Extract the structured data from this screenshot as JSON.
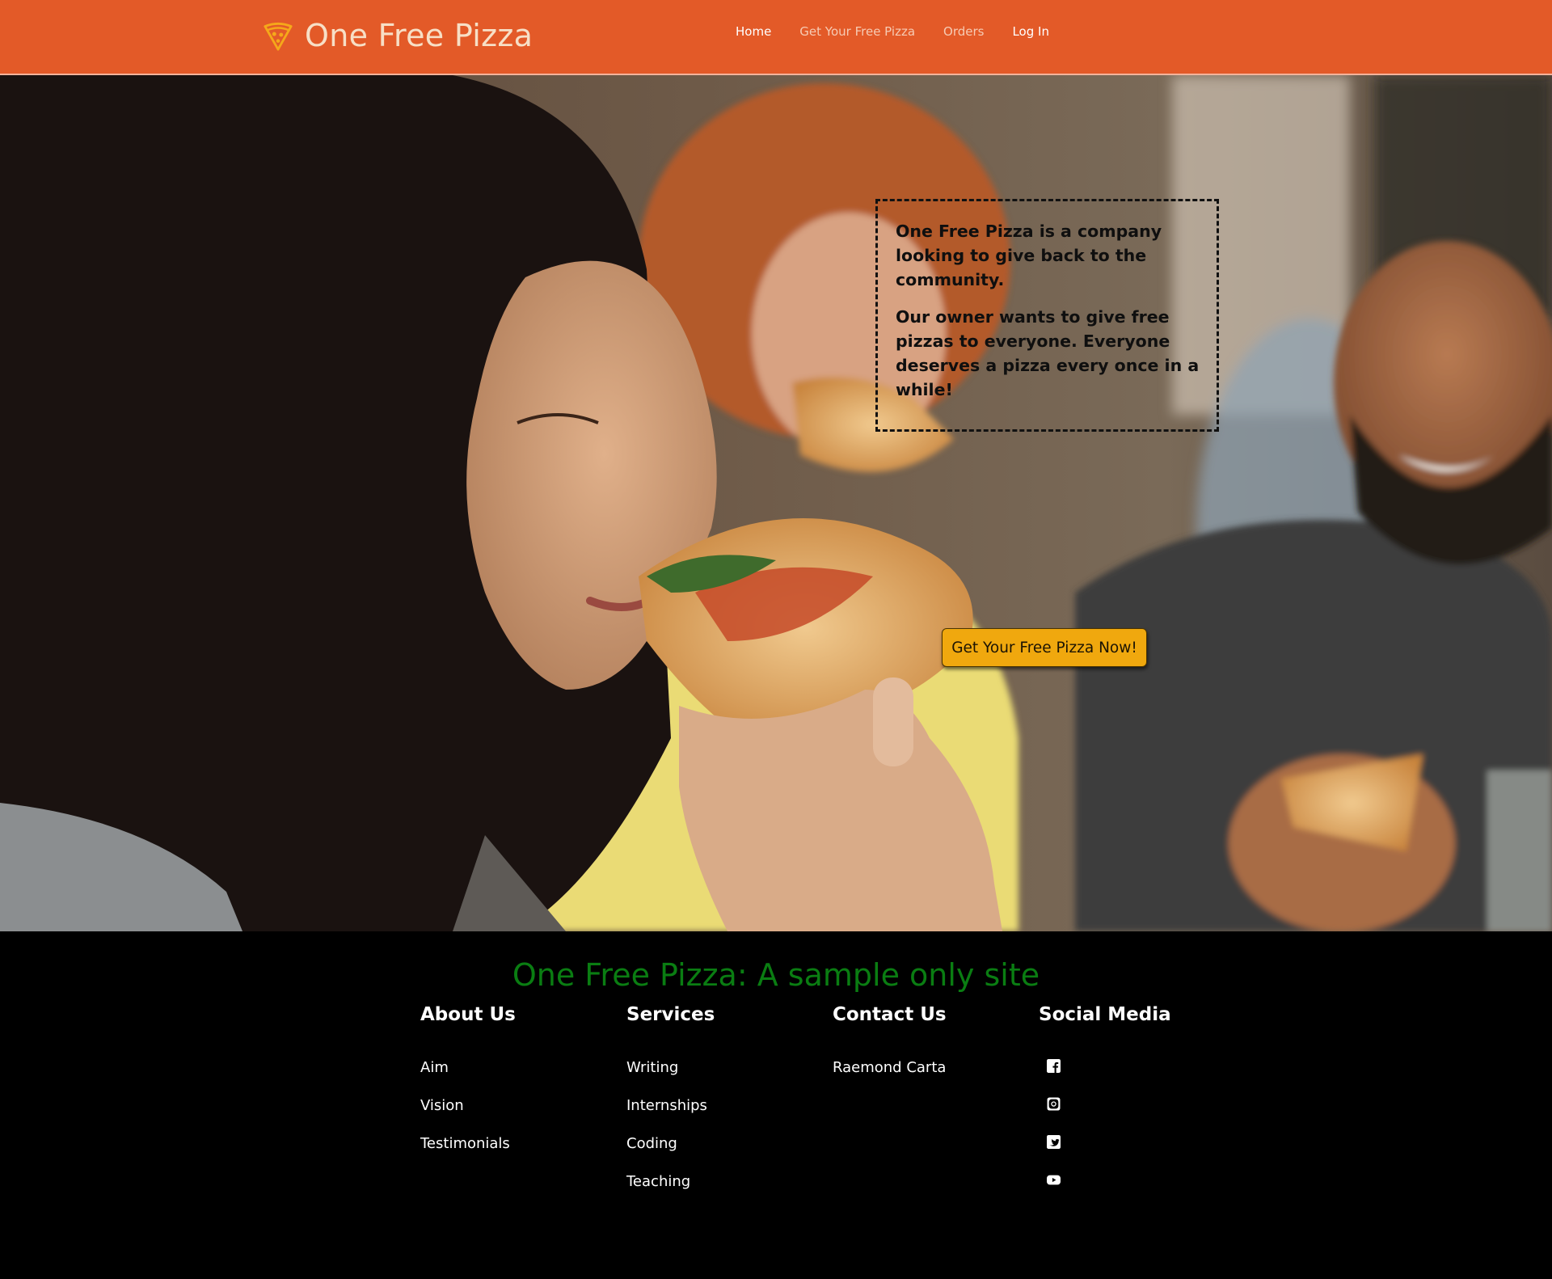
{
  "header": {
    "brand": "One Free Pizza",
    "brand_icon": "pizza-slice-icon",
    "nav": [
      {
        "label": "Home",
        "active": true
      },
      {
        "label": "Get Your Free Pizza",
        "active": false
      },
      {
        "label": "Orders",
        "active": false
      },
      {
        "label": "Log In",
        "active": false
      }
    ],
    "bg_color": "#e35a28"
  },
  "hero": {
    "about_p1": "One Free Pizza is a company looking to give back to the community.",
    "about_p2": "Our owner wants to give free pizzas to everyone. Everyone deserves a pizza every once in a while!",
    "cta_label": "Get Your Free Pizza Now!",
    "cta_color": "#f0a80e"
  },
  "footer": {
    "title": "One Free Pizza: A sample only site",
    "title_color": "#0a7d12",
    "about": {
      "heading": "About Us",
      "links": [
        "Aim",
        "Vision",
        "Testimonials"
      ]
    },
    "services": {
      "heading": "Services",
      "links": [
        "Writing",
        "Internships",
        "Coding",
        "Teaching"
      ]
    },
    "contact": {
      "heading": "Contact Us",
      "links": [
        "Raemond Carta"
      ]
    },
    "social": {
      "heading": "Social Media",
      "icons": [
        "facebook-icon",
        "instagram-icon",
        "twitter-icon",
        "youtube-icon"
      ]
    }
  }
}
